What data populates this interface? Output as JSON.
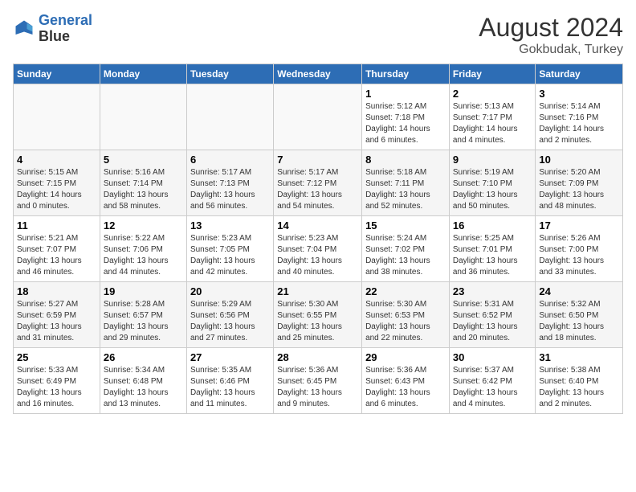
{
  "header": {
    "logo_line1": "General",
    "logo_line2": "Blue",
    "main_title": "August 2024",
    "subtitle": "Gokbudak, Turkey"
  },
  "days_of_week": [
    "Sunday",
    "Monday",
    "Tuesday",
    "Wednesday",
    "Thursday",
    "Friday",
    "Saturday"
  ],
  "weeks": [
    [
      {
        "num": "",
        "detail": ""
      },
      {
        "num": "",
        "detail": ""
      },
      {
        "num": "",
        "detail": ""
      },
      {
        "num": "",
        "detail": ""
      },
      {
        "num": "1",
        "detail": "Sunrise: 5:12 AM\nSunset: 7:18 PM\nDaylight: 14 hours\nand 6 minutes."
      },
      {
        "num": "2",
        "detail": "Sunrise: 5:13 AM\nSunset: 7:17 PM\nDaylight: 14 hours\nand 4 minutes."
      },
      {
        "num": "3",
        "detail": "Sunrise: 5:14 AM\nSunset: 7:16 PM\nDaylight: 14 hours\nand 2 minutes."
      }
    ],
    [
      {
        "num": "4",
        "detail": "Sunrise: 5:15 AM\nSunset: 7:15 PM\nDaylight: 14 hours\nand 0 minutes."
      },
      {
        "num": "5",
        "detail": "Sunrise: 5:16 AM\nSunset: 7:14 PM\nDaylight: 13 hours\nand 58 minutes."
      },
      {
        "num": "6",
        "detail": "Sunrise: 5:17 AM\nSunset: 7:13 PM\nDaylight: 13 hours\nand 56 minutes."
      },
      {
        "num": "7",
        "detail": "Sunrise: 5:17 AM\nSunset: 7:12 PM\nDaylight: 13 hours\nand 54 minutes."
      },
      {
        "num": "8",
        "detail": "Sunrise: 5:18 AM\nSunset: 7:11 PM\nDaylight: 13 hours\nand 52 minutes."
      },
      {
        "num": "9",
        "detail": "Sunrise: 5:19 AM\nSunset: 7:10 PM\nDaylight: 13 hours\nand 50 minutes."
      },
      {
        "num": "10",
        "detail": "Sunrise: 5:20 AM\nSunset: 7:09 PM\nDaylight: 13 hours\nand 48 minutes."
      }
    ],
    [
      {
        "num": "11",
        "detail": "Sunrise: 5:21 AM\nSunset: 7:07 PM\nDaylight: 13 hours\nand 46 minutes."
      },
      {
        "num": "12",
        "detail": "Sunrise: 5:22 AM\nSunset: 7:06 PM\nDaylight: 13 hours\nand 44 minutes."
      },
      {
        "num": "13",
        "detail": "Sunrise: 5:23 AM\nSunset: 7:05 PM\nDaylight: 13 hours\nand 42 minutes."
      },
      {
        "num": "14",
        "detail": "Sunrise: 5:23 AM\nSunset: 7:04 PM\nDaylight: 13 hours\nand 40 minutes."
      },
      {
        "num": "15",
        "detail": "Sunrise: 5:24 AM\nSunset: 7:02 PM\nDaylight: 13 hours\nand 38 minutes."
      },
      {
        "num": "16",
        "detail": "Sunrise: 5:25 AM\nSunset: 7:01 PM\nDaylight: 13 hours\nand 36 minutes."
      },
      {
        "num": "17",
        "detail": "Sunrise: 5:26 AM\nSunset: 7:00 PM\nDaylight: 13 hours\nand 33 minutes."
      }
    ],
    [
      {
        "num": "18",
        "detail": "Sunrise: 5:27 AM\nSunset: 6:59 PM\nDaylight: 13 hours\nand 31 minutes."
      },
      {
        "num": "19",
        "detail": "Sunrise: 5:28 AM\nSunset: 6:57 PM\nDaylight: 13 hours\nand 29 minutes."
      },
      {
        "num": "20",
        "detail": "Sunrise: 5:29 AM\nSunset: 6:56 PM\nDaylight: 13 hours\nand 27 minutes."
      },
      {
        "num": "21",
        "detail": "Sunrise: 5:30 AM\nSunset: 6:55 PM\nDaylight: 13 hours\nand 25 minutes."
      },
      {
        "num": "22",
        "detail": "Sunrise: 5:30 AM\nSunset: 6:53 PM\nDaylight: 13 hours\nand 22 minutes."
      },
      {
        "num": "23",
        "detail": "Sunrise: 5:31 AM\nSunset: 6:52 PM\nDaylight: 13 hours\nand 20 minutes."
      },
      {
        "num": "24",
        "detail": "Sunrise: 5:32 AM\nSunset: 6:50 PM\nDaylight: 13 hours\nand 18 minutes."
      }
    ],
    [
      {
        "num": "25",
        "detail": "Sunrise: 5:33 AM\nSunset: 6:49 PM\nDaylight: 13 hours\nand 16 minutes."
      },
      {
        "num": "26",
        "detail": "Sunrise: 5:34 AM\nSunset: 6:48 PM\nDaylight: 13 hours\nand 13 minutes."
      },
      {
        "num": "27",
        "detail": "Sunrise: 5:35 AM\nSunset: 6:46 PM\nDaylight: 13 hours\nand 11 minutes."
      },
      {
        "num": "28",
        "detail": "Sunrise: 5:36 AM\nSunset: 6:45 PM\nDaylight: 13 hours\nand 9 minutes."
      },
      {
        "num": "29",
        "detail": "Sunrise: 5:36 AM\nSunset: 6:43 PM\nDaylight: 13 hours\nand 6 minutes."
      },
      {
        "num": "30",
        "detail": "Sunrise: 5:37 AM\nSunset: 6:42 PM\nDaylight: 13 hours\nand 4 minutes."
      },
      {
        "num": "31",
        "detail": "Sunrise: 5:38 AM\nSunset: 6:40 PM\nDaylight: 13 hours\nand 2 minutes."
      }
    ]
  ]
}
